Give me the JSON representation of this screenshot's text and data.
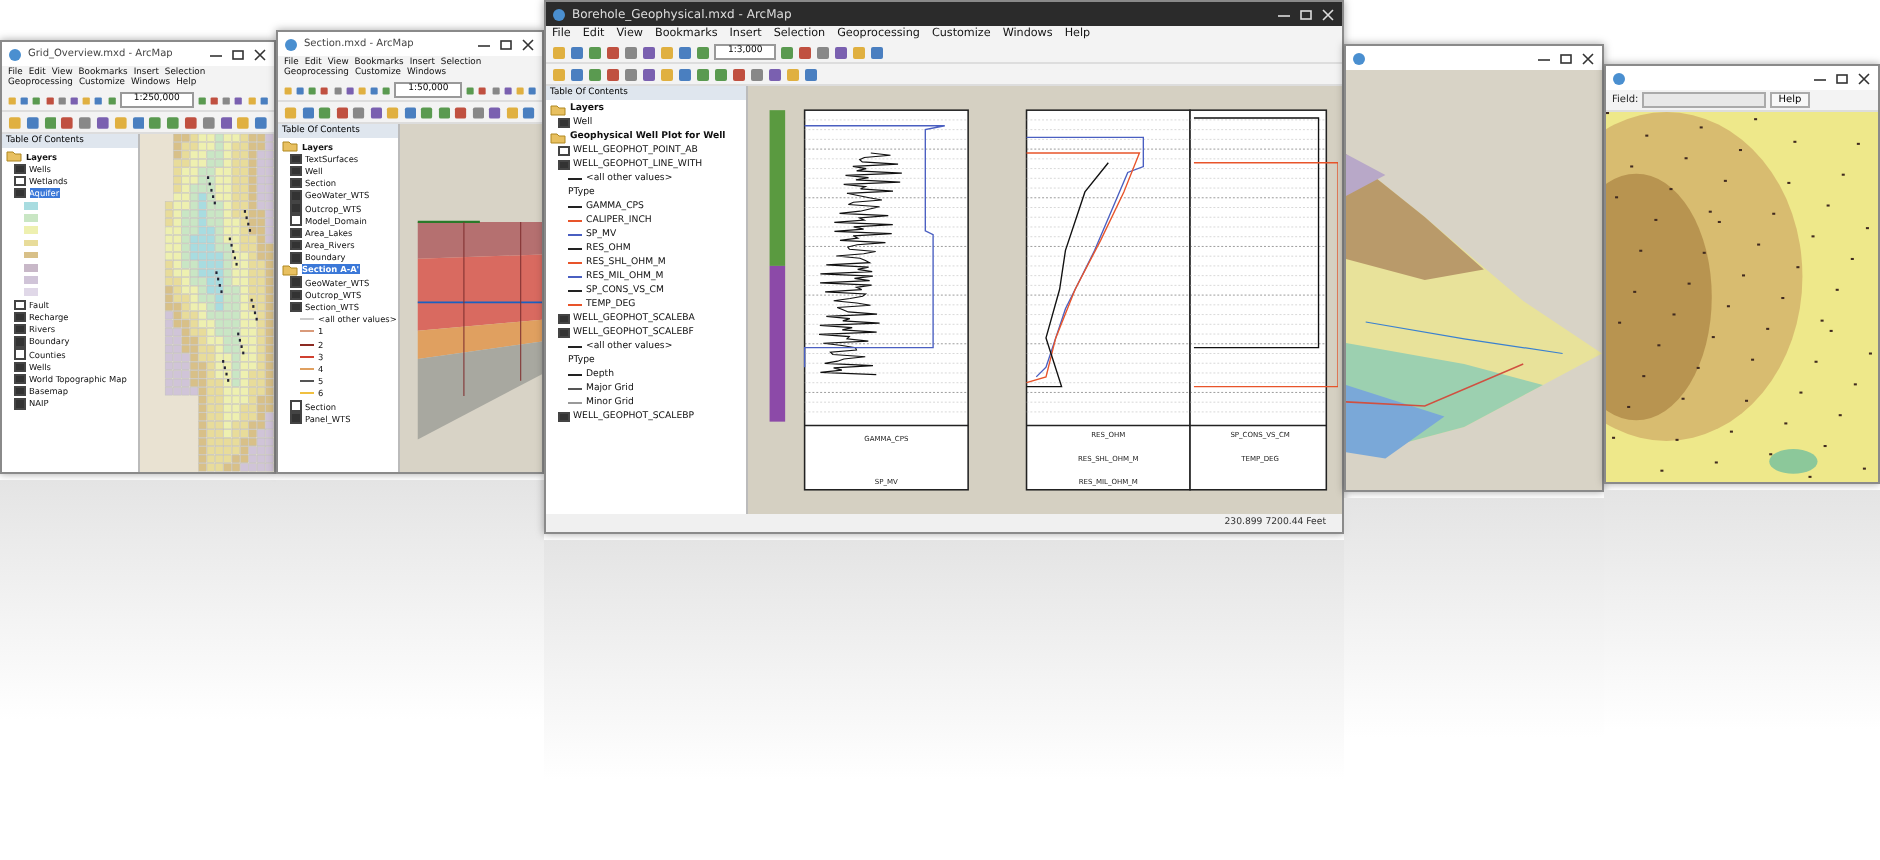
{
  "windows": [
    {
      "kind": "grid-map",
      "title": "Grid_Overview.mxd - ArcMap",
      "menu": [
        "File",
        "Edit",
        "View",
        "Bookmarks",
        "Insert",
        "Selection",
        "Geoprocessing",
        "Customize",
        "Windows",
        "Help"
      ],
      "scale": "1:250,000",
      "toc_title": "Table Of Contents",
      "toc": [
        {
          "kind": "group",
          "label": "Layers",
          "selected": false
        },
        {
          "kind": "layer",
          "label": "Wells",
          "checked": true,
          "selected": false
        },
        {
          "kind": "layer",
          "label": "Wetlands",
          "checked": false,
          "selected": false
        },
        {
          "kind": "layer",
          "label": "Aquifer",
          "checked": true,
          "selected": true
        },
        {
          "kind": "swatch",
          "color": "#a8dce0"
        },
        {
          "kind": "swatch",
          "color": "#c9e6c4"
        },
        {
          "kind": "swatch",
          "color": "#eef0b0"
        },
        {
          "kind": "swatch",
          "color": "#e8dc9a"
        },
        {
          "kind": "swatch",
          "color": "#d8c088"
        },
        {
          "kind": "swatch",
          "color": "#c8b8c8"
        },
        {
          "kind": "swatch",
          "color": "#d0c4d8"
        },
        {
          "kind": "swatch",
          "color": "#e0d8e8"
        },
        {
          "kind": "layer",
          "label": "Fault",
          "checked": false,
          "selected": false
        },
        {
          "kind": "layer",
          "label": "Recharge",
          "checked": true,
          "selected": false
        },
        {
          "kind": "layer",
          "label": "Rivers",
          "checked": true,
          "selected": false
        },
        {
          "kind": "layer",
          "label": "Boundary",
          "checked": true,
          "selected": false
        },
        {
          "kind": "layer",
          "label": "Counties",
          "checked": false,
          "selected": false
        },
        {
          "kind": "layer",
          "label": "Wells",
          "checked": true,
          "selected": false
        },
        {
          "kind": "layer",
          "label": "World Topographic Map",
          "checked": true,
          "selected": false
        },
        {
          "kind": "layer",
          "label": "Basemap",
          "checked": true,
          "selected": false
        },
        {
          "kind": "layer",
          "label": "NAIP",
          "checked": true,
          "selected": false
        }
      ]
    },
    {
      "kind": "cross-section",
      "title": "Section.mxd - ArcMap",
      "menu": [
        "File",
        "Edit",
        "View",
        "Bookmarks",
        "Insert",
        "Selection",
        "Geoprocessing",
        "Customize",
        "Windows"
      ],
      "scale": "1:50,000",
      "toc_title": "Table Of Contents",
      "toc": [
        {
          "kind": "group",
          "label": "Layers",
          "selected": false
        },
        {
          "kind": "layer",
          "label": "TextSurfaces",
          "checked": true,
          "selected": false
        },
        {
          "kind": "layer",
          "label": "Well",
          "checked": true,
          "selected": false
        },
        {
          "kind": "layer",
          "label": "Section",
          "checked": true,
          "selected": false
        },
        {
          "kind": "layer",
          "label": "GeoWater_WTS",
          "checked": true,
          "selected": false
        },
        {
          "kind": "layer",
          "label": "Outcrop_WTS",
          "checked": true,
          "selected": false
        },
        {
          "kind": "layer",
          "label": "Model_Domain",
          "checked": false,
          "selected": false
        },
        {
          "kind": "layer",
          "label": "Area_Lakes",
          "checked": true,
          "selected": false
        },
        {
          "kind": "layer",
          "label": "Area_Rivers",
          "checked": true,
          "selected": false
        },
        {
          "kind": "layer",
          "label": "Boundary",
          "checked": true,
          "selected": false
        },
        {
          "kind": "group",
          "label": "Section A-A'",
          "selected": true
        },
        {
          "kind": "layer",
          "label": "GeoWater_WTS",
          "checked": true,
          "selected": false
        },
        {
          "kind": "layer",
          "label": "Outcrop_WTS",
          "checked": true,
          "selected": false
        },
        {
          "kind": "layer",
          "label": "Section_WTS",
          "checked": true,
          "selected": false
        },
        {
          "kind": "legend",
          "label": "<all other values>",
          "color": "#cccccc"
        },
        {
          "kind": "legend",
          "label": "1",
          "color": "#d99a7a"
        },
        {
          "kind": "legend",
          "label": "2",
          "color": "#8c2a22"
        },
        {
          "kind": "legend",
          "label": "3",
          "color": "#d04030"
        },
        {
          "kind": "legend",
          "label": "4",
          "color": "#e0a060"
        },
        {
          "kind": "legend",
          "label": "5",
          "color": "#555555"
        },
        {
          "kind": "legend",
          "label": "6",
          "color": "#f0c040"
        },
        {
          "kind": "layer",
          "label": "Section",
          "checked": false,
          "selected": false
        },
        {
          "kind": "layer",
          "label": "Panel_WTS",
          "checked": true,
          "selected": false
        }
      ]
    },
    {
      "kind": "well-log",
      "title": "Borehole_Geophysical.mxd - ArcMap",
      "menu": [
        "File",
        "Edit",
        "View",
        "Bookmarks",
        "Insert",
        "Selection",
        "Geoprocessing",
        "Customize",
        "Windows",
        "Help"
      ],
      "scale": "1:3,000",
      "toc_title": "Table Of Contents",
      "toc": [
        {
          "kind": "group",
          "label": "Layers",
          "selected": false
        },
        {
          "kind": "layer",
          "label": "Well",
          "checked": true,
          "selected": false
        },
        {
          "kind": "group",
          "label": "Geophysical Well Plot for Well",
          "selected": false
        },
        {
          "kind": "layer",
          "label": "WELL_GEOPHOT_POINT_AB",
          "checked": false,
          "selected": false
        },
        {
          "kind": "layer",
          "label": "WELL_GEOPHOT_LINE_WITH",
          "checked": true,
          "selected": false
        },
        {
          "kind": "legend",
          "label": "<all other values>",
          "color": "#222222"
        },
        {
          "kind": "note",
          "label": "PType"
        },
        {
          "kind": "legend",
          "label": "GAMMA_CPS",
          "color": "#222222"
        },
        {
          "kind": "legend",
          "label": "CALIPER_INCH",
          "color": "#e8542a"
        },
        {
          "kind": "legend",
          "label": "SP_MV",
          "color": "#4a5fc1"
        },
        {
          "kind": "legend",
          "label": "RES_OHM",
          "color": "#222222"
        },
        {
          "kind": "legend",
          "label": "RES_SHL_OHM_M",
          "color": "#e8542a"
        },
        {
          "kind": "legend",
          "label": "RES_MIL_OHM_M",
          "color": "#4a5fc1"
        },
        {
          "kind": "legend",
          "label": "SP_CONS_VS_CM",
          "color": "#222222"
        },
        {
          "kind": "legend",
          "label": "TEMP_DEG",
          "color": "#e8542a"
        },
        {
          "kind": "layer",
          "label": "WELL_GEOPHOT_SCALEBA",
          "checked": true,
          "selected": false
        },
        {
          "kind": "layer",
          "label": "WELL_GEOPHOT_SCALEBF",
          "checked": true,
          "selected": false
        },
        {
          "kind": "legend",
          "label": "<all other values>",
          "color": "#222222"
        },
        {
          "kind": "note",
          "label": "PType"
        },
        {
          "kind": "legend",
          "label": "Depth",
          "color": "#222222"
        },
        {
          "kind": "legend",
          "label": "Major Grid",
          "color": "#555555"
        },
        {
          "kind": "legend",
          "label": "Minor Grid",
          "color": "#999999"
        },
        {
          "kind": "layer",
          "label": "WELL_GEOPHOT_SCALEBP",
          "checked": true,
          "selected": false
        }
      ],
      "track_labels": [
        "GAMMA_CPS",
        "SP_MV",
        "RES_OHM",
        "RES_SHL_OHM_M",
        "RES_MIL_OHM_M",
        "SP_CONS_VS_CM",
        "TEMP_DEG"
      ],
      "status": "230.899  7200.44 Feet"
    },
    {
      "kind": "terrain"
    },
    {
      "kind": "contour",
      "field_label": "Field:",
      "button": "Help"
    }
  ]
}
